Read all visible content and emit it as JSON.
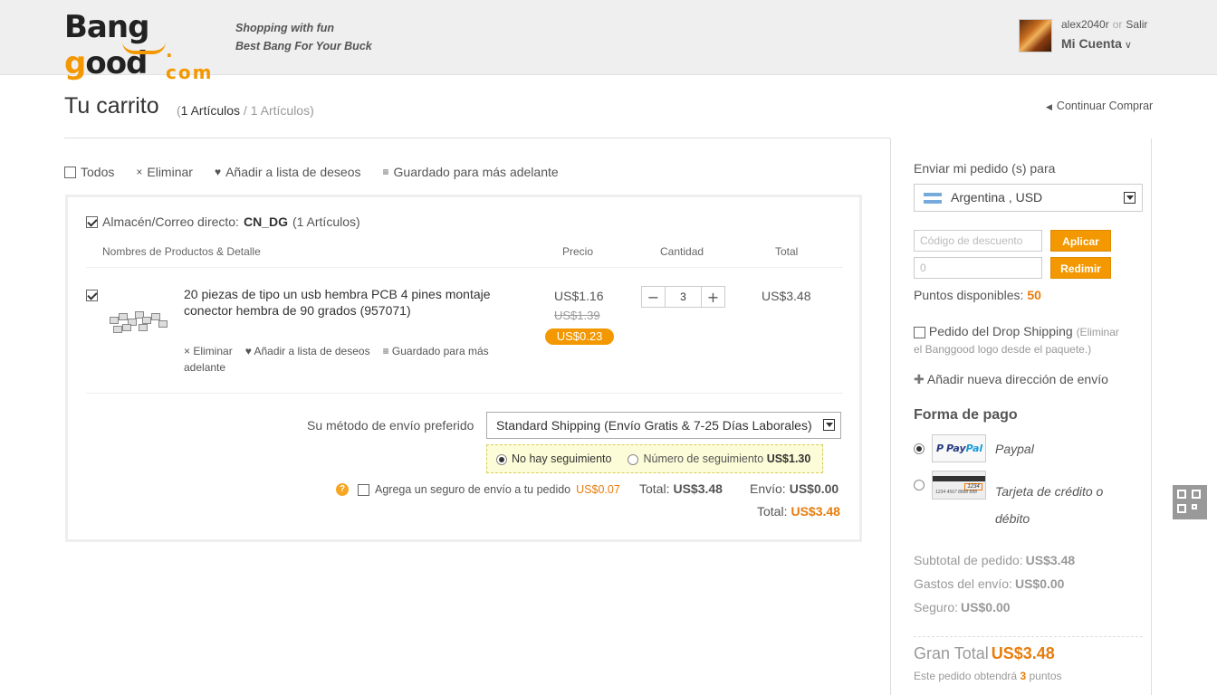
{
  "header": {
    "logo_top_a": "Bang",
    "logo_top_b": "g",
    "logo_top_c": "ood",
    "logo_bottom": ". com",
    "slogan_line1": "Shopping with fun",
    "slogan_line2": "Best Bang For Your Buck",
    "username": "alex2040r",
    "or": "or",
    "logout": "Salir",
    "account": "Mi Cuenta"
  },
  "cart": {
    "title": "Tu carrito",
    "count_main": "1 Artículos",
    "count_sep": " / ",
    "count_secondary": "1 Artículos)",
    "paren_open": "(",
    "continue": "Continuar Comprar"
  },
  "actions": {
    "all": "Todos",
    "delete": "Eliminar",
    "wishlist": "Añadir a lista de deseos",
    "saved": "Guardado para más adelante"
  },
  "warehouse": {
    "label": "Almacén/Correo directo:",
    "code": "CN_DG",
    "count": "(1 Artículos)"
  },
  "columns": {
    "product": "Nombres de Productos & Detalle",
    "price": "Precio",
    "qty": "Cantidad",
    "total": "Total"
  },
  "product": {
    "name": "20 piezas de tipo un usb hembra PCB 4 pines montaje conector hembra de 90 grados (957071)",
    "link_delete": "Eliminar",
    "link_wishlist": "Añadir a lista de deseos",
    "link_saved": "Guardado para más adelante",
    "price": "US$1.16",
    "old_price": "US$1.39",
    "saving": "US$0.23",
    "quantity": "3",
    "line_total": "US$3.48"
  },
  "shipping": {
    "label": "Su método de envío preferido",
    "method": "Standard Shipping (Envío Gratis & 7-25 Días Laborales)",
    "no_tracking": "No hay seguimiento",
    "tracking_label": "Número de seguimiento",
    "tracking_price": "US$1.30",
    "insurance_label": "Agrega un seguro de envío a tu pedido",
    "insurance_price": "US$0.07",
    "total_label": "Total:",
    "total_value": "US$3.48",
    "ship_label": "Envío:",
    "ship_value": "US$0.00",
    "grand_label": "Total:",
    "grand_value": "US$3.48"
  },
  "sidebar": {
    "ship_to": "Enviar mi pedido (s) para",
    "country": "Argentina , USD",
    "coupon_placeholder": "Código de descuento",
    "apply": "Aplicar",
    "points_input": "0",
    "redeem": "Redimir",
    "points_label": "Puntos disponibles:",
    "points_value": "50",
    "drop_label": "Pedido del Drop Shipping",
    "drop_sub1": "(Eliminar",
    "drop_sub2": "el Banggood logo desde el paquete.)",
    "add_address": "Añadir nueva dirección de envío",
    "payment_title": "Forma de pago",
    "paypal_pay": "Pay",
    "paypal_pal": "Pal",
    "paypal": "Paypal",
    "card_line1": "Tarjeta de crédito o",
    "card_line2": "débito",
    "card_number": "1234 4567 8888 888",
    "card_tag": "1234",
    "subtotal_label": "Subtotal de pedido:",
    "subtotal_value": "US$3.48",
    "shipping_label": "Gastos del envío:",
    "shipping_value": "US$0.00",
    "insurance_label": "Seguro:",
    "insurance_value": "US$0.00",
    "grand_label": "Gran Total",
    "grand_value": "US$3.48",
    "earned_a": "Este pedido obtendrá",
    "earned_points": "3",
    "earned_b": "puntos"
  },
  "colors": {
    "accent": "#f39800",
    "price_highlight": "#e87c0c"
  }
}
